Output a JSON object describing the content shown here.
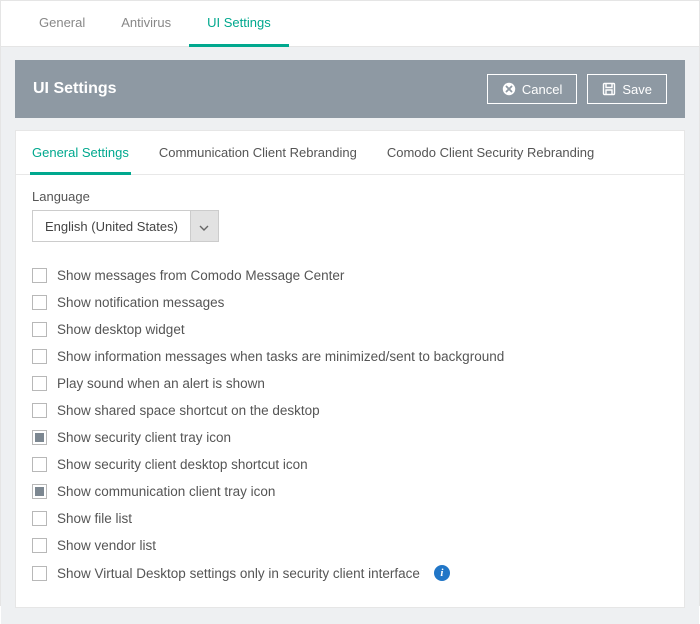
{
  "topTabs": [
    {
      "id": "general",
      "label": "General",
      "active": false
    },
    {
      "id": "antivirus",
      "label": "Antivirus",
      "active": false
    },
    {
      "id": "uisettings",
      "label": "UI Settings",
      "active": true
    }
  ],
  "panel": {
    "title": "UI Settings",
    "cancel": "Cancel",
    "save": "Save"
  },
  "subTabs": [
    {
      "id": "gen",
      "label": "General Settings",
      "active": true
    },
    {
      "id": "comm",
      "label": "Communication Client Rebranding",
      "active": false
    },
    {
      "id": "sec",
      "label": "Comodo Client Security Rebranding",
      "active": false
    }
  ],
  "language": {
    "label": "Language",
    "value": "English (United States)"
  },
  "options": [
    {
      "label": "Show messages from Comodo Message Center",
      "checked": false,
      "info": false
    },
    {
      "label": "Show notification messages",
      "checked": false,
      "info": false
    },
    {
      "label": "Show desktop widget",
      "checked": false,
      "info": false
    },
    {
      "label": "Show information messages when tasks are minimized/sent to background",
      "checked": false,
      "info": false
    },
    {
      "label": "Play sound when an alert is shown",
      "checked": false,
      "info": false
    },
    {
      "label": "Show shared space shortcut on the desktop",
      "checked": false,
      "info": false
    },
    {
      "label": "Show security client tray icon",
      "checked": true,
      "info": false
    },
    {
      "label": "Show security client desktop shortcut icon",
      "checked": false,
      "info": false
    },
    {
      "label": "Show communication client tray icon",
      "checked": true,
      "info": false
    },
    {
      "label": "Show file list",
      "checked": false,
      "info": false
    },
    {
      "label": "Show vendor list",
      "checked": false,
      "info": false
    },
    {
      "label": "Show Virtual Desktop settings only in security client interface",
      "checked": false,
      "info": true
    }
  ]
}
